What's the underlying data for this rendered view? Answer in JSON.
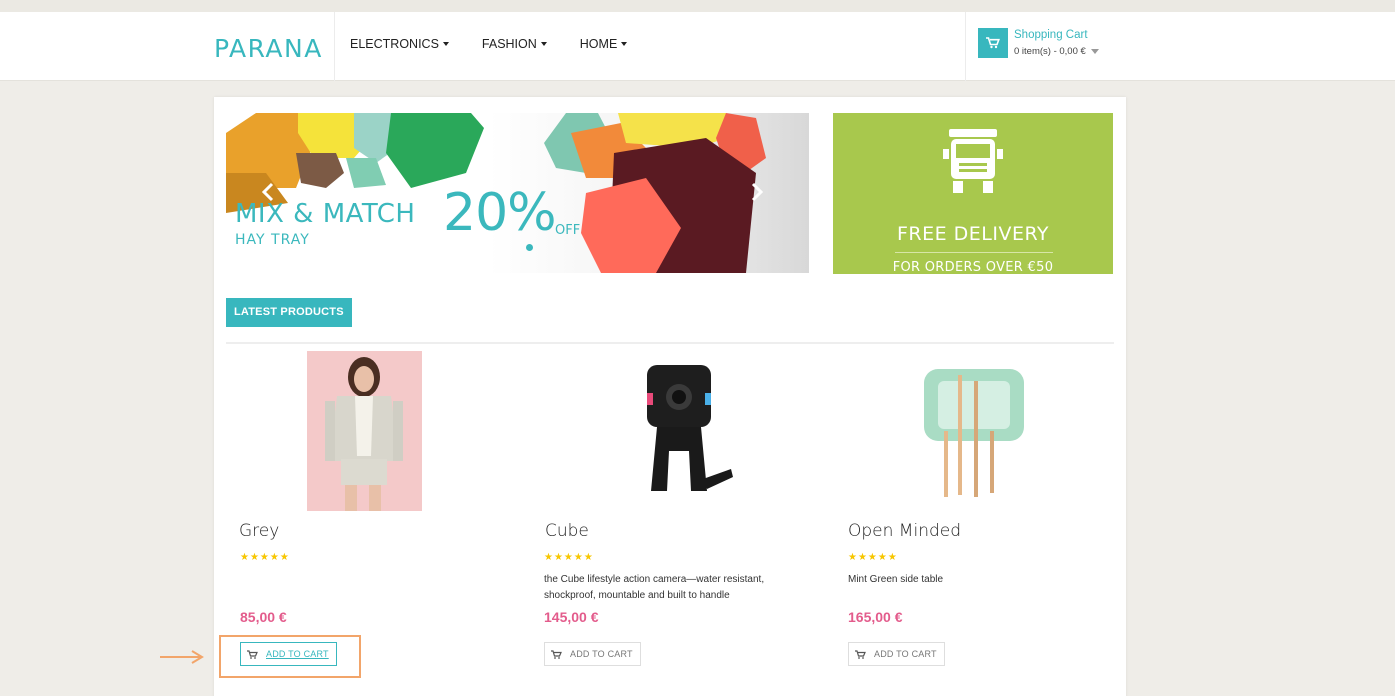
{
  "brand": {
    "logo": "PARANA",
    "accent": "#38b7be"
  },
  "nav": [
    {
      "label": "ELECTRONICS"
    },
    {
      "label": "FASHION"
    },
    {
      "label": "HOME"
    }
  ],
  "cart": {
    "title": "Shopping Cart",
    "summary": "0 item(s) - 0,00 €",
    "icon": "cart-icon"
  },
  "slider": {
    "line1": "MIX & MATCH",
    "line2": "HAY TRAY",
    "percent": "20%",
    "off": "OFF",
    "prev_icon": "chevron-left-icon",
    "next_icon": "chevron-right-icon"
  },
  "promo": {
    "title": "FREE DELIVERY",
    "subtitle": "FOR ORDERS OVER €50",
    "icon": "truck-icon",
    "color": "#a8c84d"
  },
  "section": {
    "title": "LATEST PRODUCTS"
  },
  "products": [
    {
      "name": "Grey",
      "stars": "★★★★★",
      "description": "",
      "price": "85,00 €",
      "button": "ADD TO CART"
    },
    {
      "name": "Cube",
      "stars": "★★★★★",
      "description": "the Cube lifestyle action camera—water resistant, shockproof, mountable and built to handle",
      "price": "145,00 €",
      "button": "ADD TO CART"
    },
    {
      "name": "Open Minded",
      "stars": "★★★★★",
      "description": "Mint Green side table",
      "price": "165,00 €",
      "button": "ADD TO CART"
    }
  ],
  "colors": {
    "price": "#e35c8c",
    "stars": "#f7c600",
    "highlight": "#f2a56a"
  }
}
